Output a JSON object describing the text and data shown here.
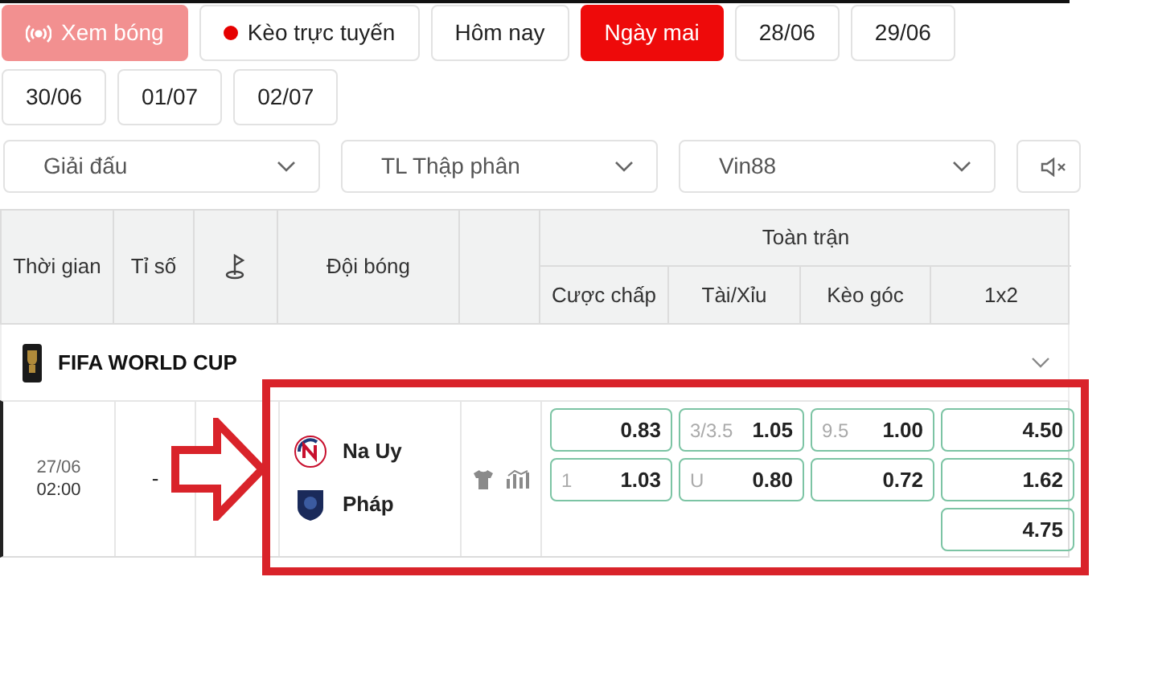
{
  "filters": [
    {
      "kind": "watch",
      "label": "Xem bóng",
      "selected": false
    },
    {
      "kind": "live",
      "label": "Kèo trực tuyến",
      "selected": false
    },
    {
      "kind": "date",
      "label": "Hôm nay",
      "selected": false
    },
    {
      "kind": "date",
      "label": "Ngày mai",
      "selected": true
    },
    {
      "kind": "date",
      "label": "28/06",
      "selected": false
    },
    {
      "kind": "date",
      "label": "29/06",
      "selected": false
    },
    {
      "kind": "date",
      "label": "30/06",
      "selected": false
    },
    {
      "kind": "date",
      "label": "01/07",
      "selected": false
    },
    {
      "kind": "date",
      "label": "02/07",
      "selected": false
    }
  ],
  "dropdowns": [
    {
      "value": "Giải đấu"
    },
    {
      "value": "TL Thập phân"
    },
    {
      "value": "Vin88"
    }
  ],
  "table": {
    "columns": [
      "Thời gian",
      "Tỉ số",
      "Đội bóng"
    ],
    "group_heading": "Toàn trận",
    "sub_columns": [
      "Cược chấp",
      "Tài/Xỉu",
      "Kèo góc",
      "1x2"
    ]
  },
  "league": {
    "name": "FIFA WORLD CUP",
    "expanded": true
  },
  "match": {
    "date": "27/06",
    "time": "02:00",
    "score": "-",
    "teams": [
      "Na Uy",
      "Pháp"
    ],
    "odds": [
      {
        "cells": [
          {
            "value": "0.83"
          },
          {
            "label": "1",
            "value": "1.03"
          }
        ]
      },
      {
        "cells": [
          {
            "label": "3/3.5",
            "value": "1.05"
          },
          {
            "label": "U",
            "value": "0.80"
          }
        ]
      },
      {
        "cells": [
          {
            "label": "9.5",
            "value": "1.00"
          },
          {
            "value": "0.72"
          }
        ]
      },
      {
        "cells": [
          {
            "value": "4.50"
          },
          {
            "value": "1.62"
          },
          {
            "value": "4.75"
          }
        ]
      }
    ]
  }
}
